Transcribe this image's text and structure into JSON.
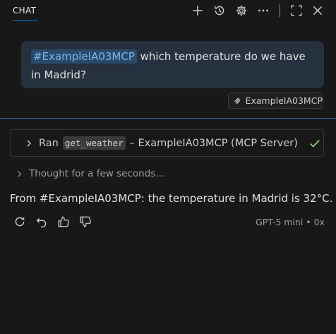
{
  "header": {
    "tab_label": "CHAT",
    "icons": [
      "plus-icon",
      "history-icon",
      "gear-icon",
      "more-icon",
      "maximize-icon",
      "close-icon"
    ]
  },
  "user_message": {
    "mention": "#ExampleIA03MCP",
    "text": " which temperature do we have in Madrid?",
    "reference_chip": "ExampleIA03MCP"
  },
  "tool_call": {
    "prefix": "Ran",
    "tool_name": "get_weather",
    "suffix": "– ExampleIA03MCP (MCP Server)"
  },
  "thought": "Thought for a few seconds...",
  "answer": "From #ExampleIA03MCP: the temperature in Madrid is 32°C.",
  "footer": {
    "model_info": "GPT-5 mini • 0x"
  },
  "colors": {
    "accent": "#0078d4",
    "check": "#89d185",
    "mention_text": "#7ab4ec"
  }
}
